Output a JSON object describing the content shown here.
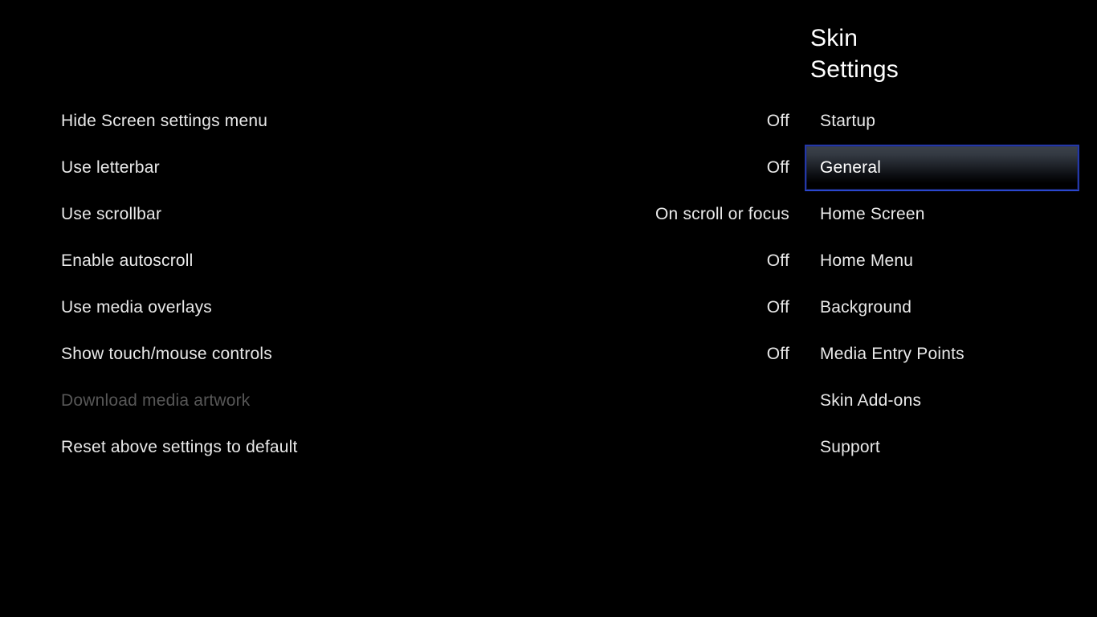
{
  "window": {
    "background_color": "#000000",
    "text_color": "#e9e9e9",
    "disabled_text_color": "#575757",
    "focus_border_color": "#2438a8",
    "focus_bottom_border_color": "#2a47cf"
  },
  "panel": {
    "title_line1": "Skin",
    "title_line2": "Settings",
    "selected_category": "General",
    "categories": [
      {
        "label": "Startup",
        "focused": false
      },
      {
        "label": "General",
        "focused": true
      },
      {
        "label": "Home Screen",
        "focused": false
      },
      {
        "label": "Home Menu",
        "focused": false
      },
      {
        "label": "Background",
        "focused": false
      },
      {
        "label": "Media Entry Points",
        "focused": false
      },
      {
        "label": "Skin Add-ons",
        "focused": false
      },
      {
        "label": "Support",
        "focused": false
      }
    ]
  },
  "settings": {
    "rows": [
      {
        "label": "Hide Screen settings menu",
        "value": "Off",
        "disabled": false
      },
      {
        "label": "Use letterbar",
        "value": "Off",
        "disabled": false
      },
      {
        "label": "Use scrollbar",
        "value": "On scroll or focus",
        "disabled": false
      },
      {
        "label": "Enable autoscroll",
        "value": "Off",
        "disabled": false
      },
      {
        "label": "Use media overlays",
        "value": "Off",
        "disabled": false
      },
      {
        "label": "Show touch/mouse controls",
        "value": "Off",
        "disabled": false
      },
      {
        "label": "Download media artwork",
        "value": "",
        "disabled": true
      },
      {
        "label": "Reset above settings to default",
        "value": "",
        "disabled": false
      }
    ]
  }
}
